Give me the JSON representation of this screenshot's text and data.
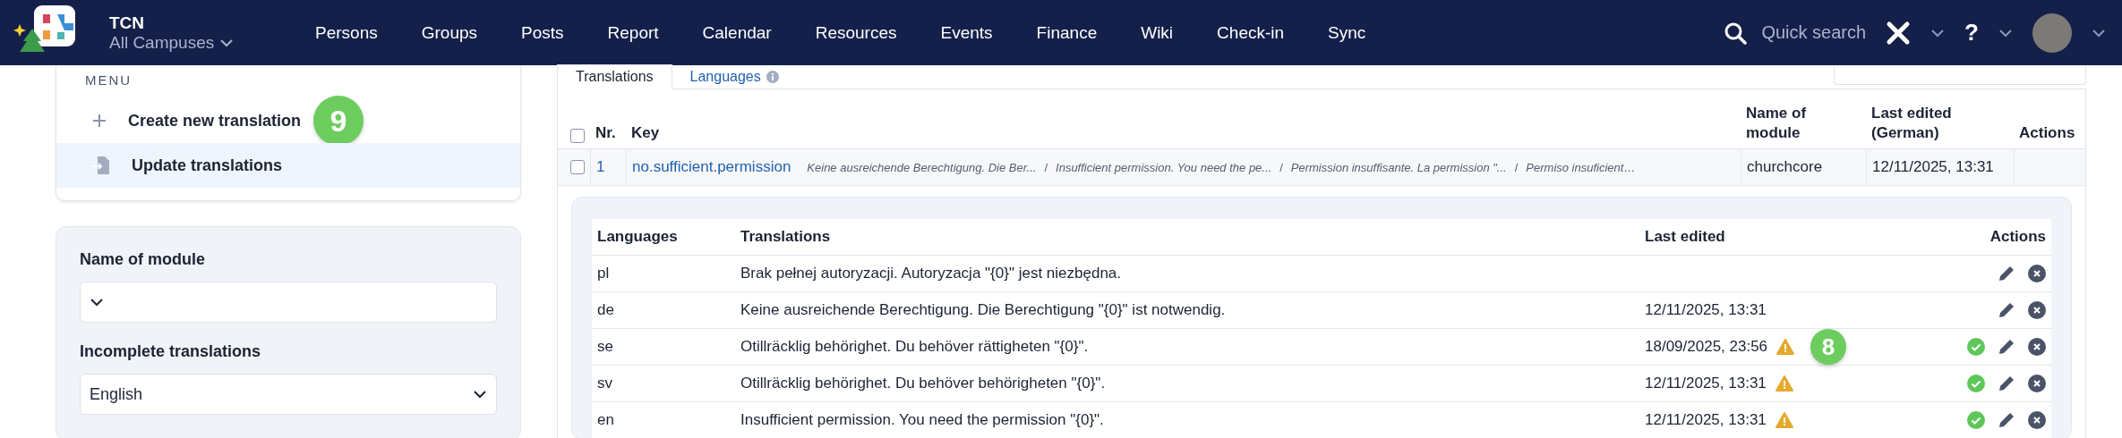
{
  "nav": {
    "title": "TCN",
    "campus": "All Campuses",
    "items": [
      "Persons",
      "Groups",
      "Posts",
      "Report",
      "Calendar",
      "Resources",
      "Events",
      "Finance",
      "Wiki",
      "Check-in",
      "Sync"
    ],
    "search_placeholder": "Quick search",
    "help": "?"
  },
  "menu": {
    "heading": "MENU",
    "items": [
      {
        "kind": "create",
        "label": "Create new translation",
        "selected": false,
        "badge": "9"
      },
      {
        "kind": "update",
        "label": "Update translations",
        "selected": true
      }
    ]
  },
  "filters": [
    {
      "label": "Name of module"
    },
    {
      "label": "Incomplete translations",
      "value": "English"
    }
  ],
  "tabs": [
    {
      "label": "Translations",
      "selected": true
    },
    {
      "label": "Languages",
      "selected": false
    }
  ],
  "table": {
    "all_checked": false,
    "columns": [
      "Nr.",
      "Key",
      "Name of module",
      "Last edited (German)",
      "Actions"
    ],
    "rows": [
      {
        "checked": false,
        "nr": "1",
        "key": "no.sufficient.permission",
        "previews": [
          "Keine ausreichende Berechtigung. Die Ber...",
          "Insufficient permission. You need the pe...",
          "Permission insuffisante. La permission \"...",
          "Permiso insuficient…"
        ],
        "separators": [
          "/",
          "/",
          "/"
        ],
        "module": "churchcore",
        "last_edited": "12/11/2025, 13:31"
      }
    ]
  },
  "detail": {
    "columns": [
      "Languages",
      "Translations",
      "Last edited",
      "Actions"
    ],
    "rows": [
      {
        "language": "pl",
        "translation": "Brak pełnej autoryzacji. Autoryzacja \"{0}\" jest niezbędna.",
        "warning": false,
        "approvable": false
      },
      {
        "language": "de",
        "translation": "Keine ausreichende Berechtigung. Die Berechtigung \"{0}\" ist notwendig.",
        "last_edited": "12/11/2025, 13:31",
        "warning": false,
        "approvable": false
      },
      {
        "language": "se",
        "translation": "Otillräcklig behörighet. Du behöver rättigheten \"{0}\".",
        "last_edited": "18/09/2025, 23:56",
        "warning": true,
        "approvable": true,
        "badge": "8"
      },
      {
        "language": "sv",
        "translation": "Otillräcklig behörighet. Du behöver behörigheten \"{0}\".",
        "last_edited": "12/11/2025, 13:31",
        "warning": true,
        "approvable": true
      },
      {
        "language": "en",
        "translation": "Insufficient permission. You need the permission \"{0}\".",
        "last_edited": "12/11/2025, 13:31",
        "warning": true,
        "approvable": true
      }
    ]
  }
}
